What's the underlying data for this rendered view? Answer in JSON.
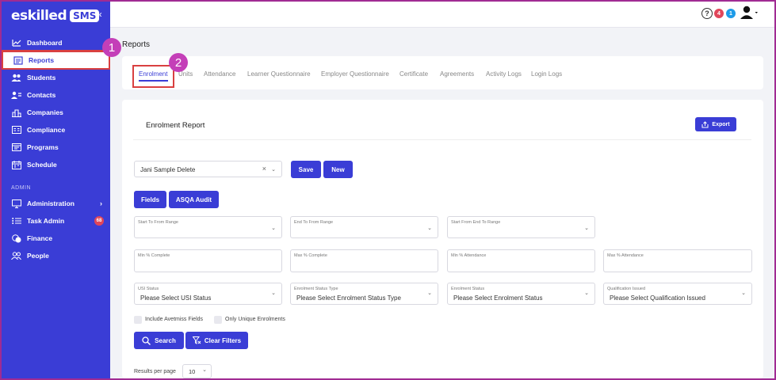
{
  "brand": {
    "logo_text": "eskilled",
    "logo_badge": "SMS",
    "collapse": "«"
  },
  "sidebar": {
    "items": [
      {
        "label": "Dashboard"
      },
      {
        "label": "Reports"
      },
      {
        "label": "Students"
      },
      {
        "label": "Contacts"
      },
      {
        "label": "Companies"
      },
      {
        "label": "Compliance"
      },
      {
        "label": "Programs"
      },
      {
        "label": "Schedule"
      }
    ],
    "section_admin": "ADMIN",
    "admin_items": [
      {
        "label": "Administration"
      },
      {
        "label": "Task Admin",
        "badge": "68"
      },
      {
        "label": "Finance"
      },
      {
        "label": "People"
      }
    ]
  },
  "topbar": {
    "help": "?",
    "notif_red": "4",
    "notif_blue": "1"
  },
  "callouts": {
    "one": "1",
    "two": "2"
  },
  "page": {
    "title": "Reports"
  },
  "tabs": [
    "Enrolment",
    "Units",
    "Attendance",
    "Learner Questionnaire",
    "Employer Questionnaire",
    "Certificate",
    "Agreements",
    "Activity Logs",
    "Login Logs"
  ],
  "report": {
    "title": "Enrolment Report",
    "export_label": "Export",
    "saved_report": "Jani Sample Delete",
    "clear_x": "×",
    "save_label": "Save",
    "new_label": "New",
    "fields_label": "Fields",
    "asqa_label": "ASQA Audit"
  },
  "filters": {
    "row1": [
      {
        "label": "Start To From Range"
      },
      {
        "label": "End To From Range"
      },
      {
        "label": "Start From End To Range"
      }
    ],
    "row2": [
      {
        "label": "Min % Complete"
      },
      {
        "label": "Max % Complete"
      },
      {
        "label": "Min % Attendance"
      },
      {
        "label": "Max % Attendance"
      }
    ],
    "row3": [
      {
        "label": "USI Status",
        "value": "Please Select USI Status"
      },
      {
        "label": "Enrolment Status Type",
        "value": "Please Select Enrolment Status Type"
      },
      {
        "label": "Enrolment Status",
        "value": "Please Select Enrolment Status"
      },
      {
        "label": "Qualification Issued",
        "value": "Please Select Qualification Issued"
      }
    ],
    "include_avetmiss": "Include Avetmiss Fields",
    "only_unique": "Only Unique Enrolments",
    "search_label": "Search",
    "clear_filters_label": "Clear Filters"
  },
  "pagination": {
    "results_per_page_label": "Results per page",
    "results_per_page": "10"
  },
  "colors": {
    "primary": "#3a3dd6",
    "callout": "#c43fb8",
    "highlight": "#d94040"
  }
}
